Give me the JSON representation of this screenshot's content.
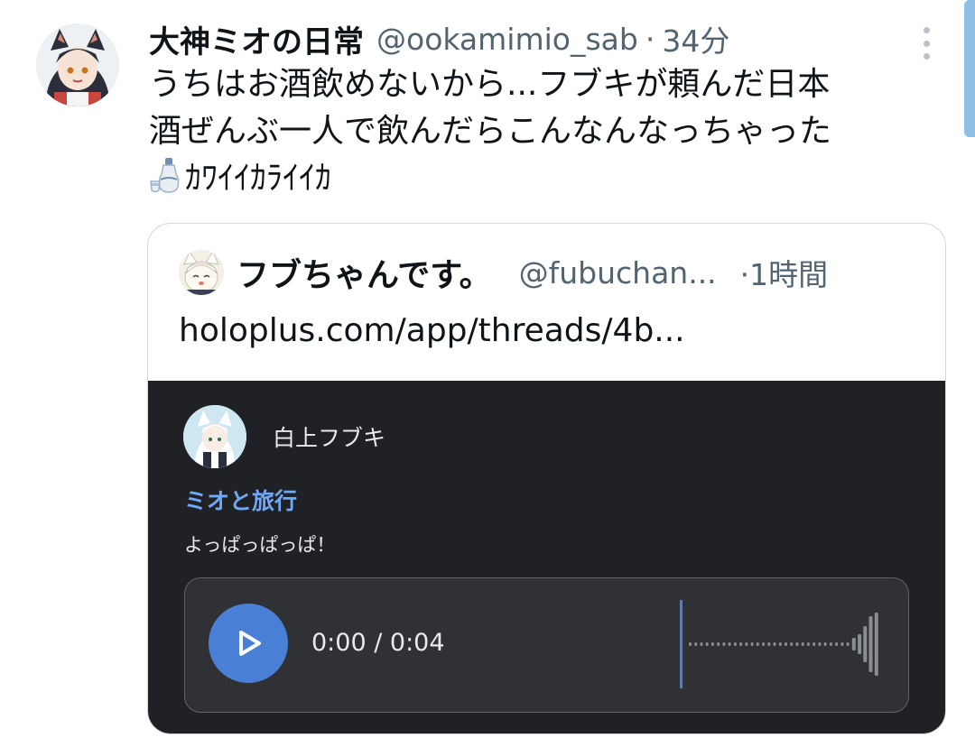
{
  "tweet": {
    "display_name": "大神ミオの日常",
    "handle": "@ookamimio_sab",
    "separator": "·",
    "time": "34分",
    "text_line1": "うちはお酒飲めないから...フブキが頼んだ日本",
    "text_line2": "酒ぜんぶ一人で飲んだらこんなんなっちゃった",
    "text_line3": "ｶﾜｲｲｶﾗｲｲｶ",
    "emoji": "sake-icon"
  },
  "quote": {
    "display_name": "フブちゃんです。",
    "handle": "@fubuchan...",
    "time": "·1時間",
    "link_text": "holoplus.com/app/threads/4b..."
  },
  "embed": {
    "author": "白上フブキ",
    "title": "ミオと旅行",
    "body": "よっぱっぱっぱ！",
    "player": {
      "time_display": "0:00 / 0:04",
      "progress": 0
    }
  },
  "colors": {
    "accent_blue": "#4a7fd6",
    "title_blue": "#6fa8f7",
    "embed_bg": "#202124",
    "muted_text": "#536471"
  }
}
